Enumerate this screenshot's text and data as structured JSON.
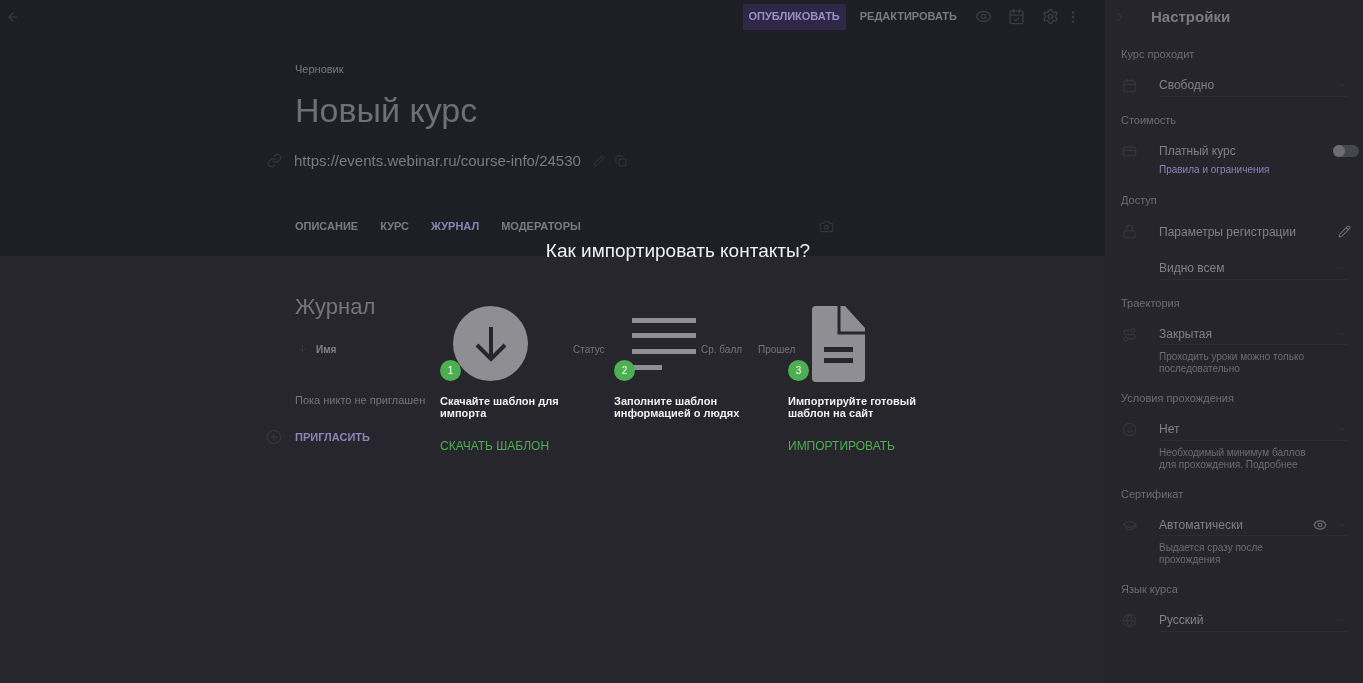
{
  "top_bar": {
    "buttons": [
      {
        "label": "ОПУБЛИКОВАТЬ",
        "kind": "primary"
      },
      {
        "label": "РЕДАКТИРОВАТЬ",
        "kind": "text"
      }
    ]
  },
  "course": {
    "status": "Черновик",
    "title": "Новый курс",
    "url": "https://events.webinar.ru/course-info/24530"
  },
  "tabs": [
    {
      "label": "ОПИСАНИЕ",
      "selected": false
    },
    {
      "label": "КУРС",
      "selected": false
    },
    {
      "label": "ЖУРНАЛ",
      "selected": true
    },
    {
      "label": "МОДЕРАТОРЫ",
      "selected": false
    }
  ],
  "journal": {
    "title": "Журнал",
    "columns": [
      "Имя",
      "Статус",
      "Ср. балл",
      "Прошел"
    ],
    "empty_text": "Пока никто не приглашен",
    "invite": "ПРИГЛАСИТЬ"
  },
  "dialog": {
    "title": "Как импортировать контакты?",
    "steps": [
      {
        "number": "1",
        "kind": "download",
        "text": "Скачайте шаблон для импорта",
        "action": "СКАЧАТЬ ШАБЛОН"
      },
      {
        "number": "2",
        "kind": "fill",
        "text": "Заполните шаблон информацией о людях"
      },
      {
        "number": "3",
        "kind": "upload",
        "text": "Импортируйте готовый шаблон на сайт",
        "action": "ИМПОРТИРОВАТЬ"
      }
    ]
  },
  "settings": {
    "title": "Настройки",
    "sections": [
      {
        "label": "Курс проходит",
        "kind": "select",
        "value": "Свободно"
      },
      {
        "label": "Стоимость",
        "kind": "toggle",
        "value": "Платный курс",
        "link": "Правила и ограничения",
        "on": false
      },
      {
        "label": "Доступ",
        "kind": "edit",
        "value": "Параметры регистрации"
      },
      {
        "kind": "select",
        "value": "Видно всем"
      },
      {
        "label": "Траектория",
        "kind": "select",
        "value": "Закрытая",
        "hint": "Проходить уроки можно только последовательно"
      },
      {
        "label": "Условия прохождения",
        "kind": "select",
        "value": "Нет",
        "hint": "Необходимый минимум баллов для прохождения. Подробнее"
      },
      {
        "label": "Сертификат",
        "kind": "select",
        "value": "Автоматически",
        "hint": "Выдается сразу после прохождения",
        "visible": true
      },
      {
        "label": "Язык курса",
        "kind": "select",
        "value": "Русский"
      }
    ]
  }
}
